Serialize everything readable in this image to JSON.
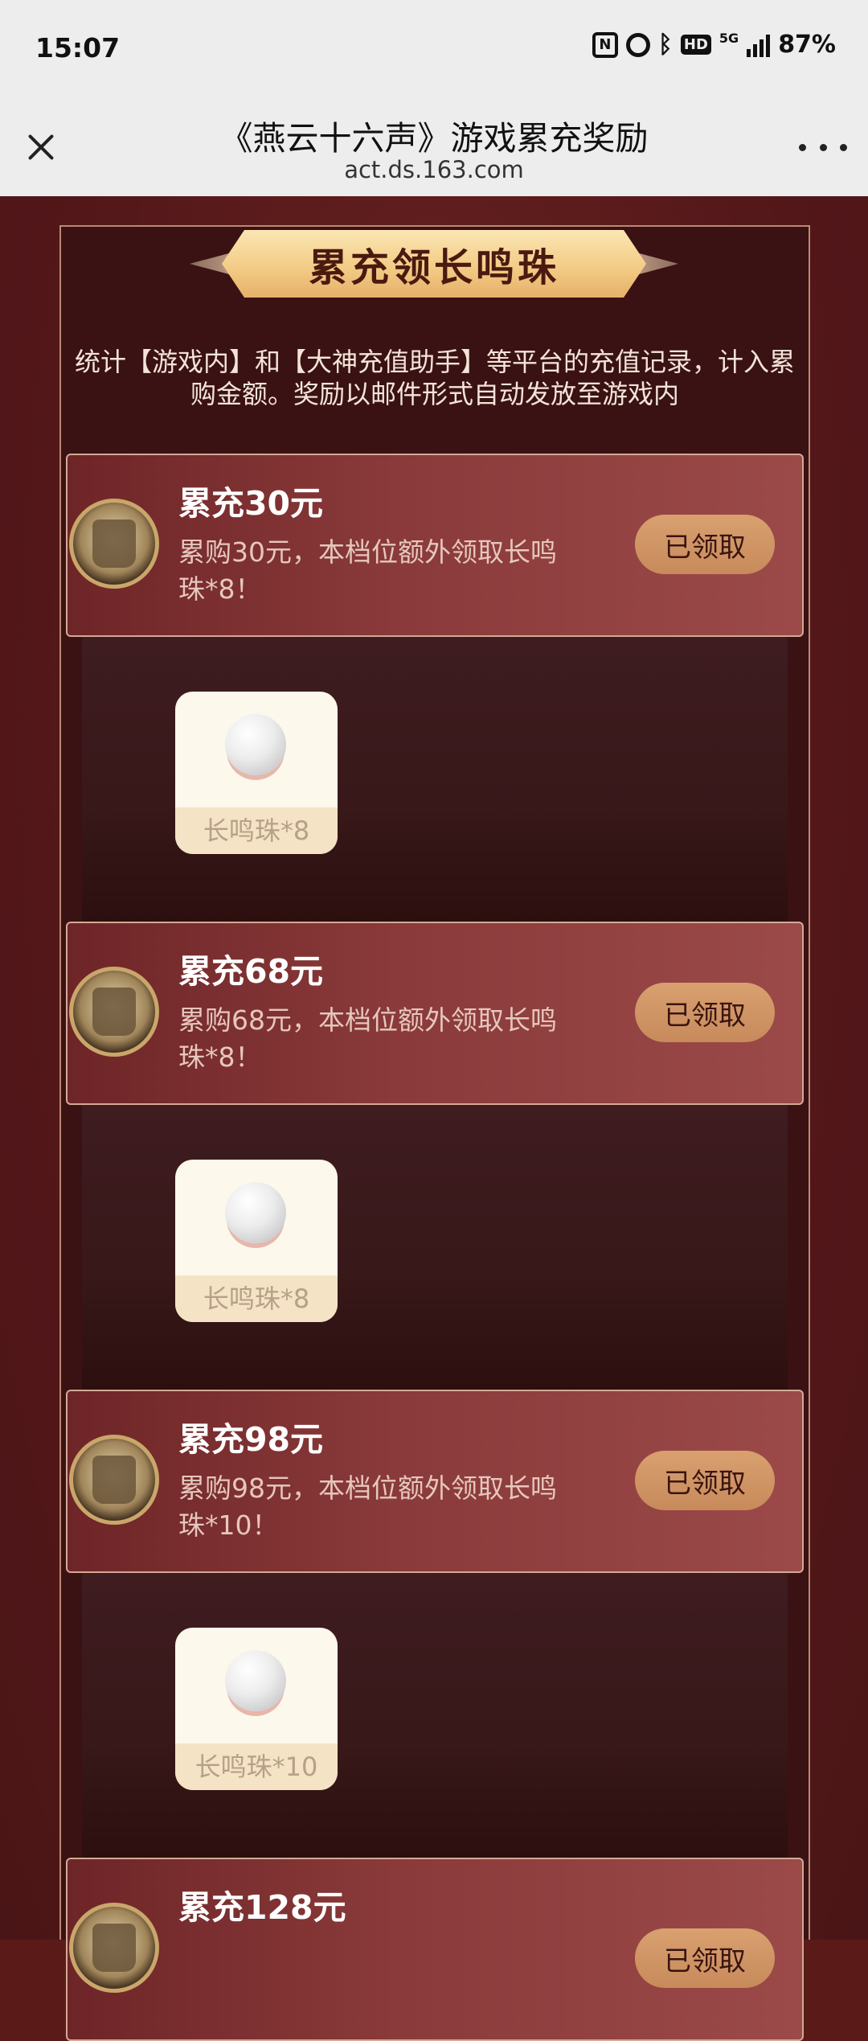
{
  "status_bar": {
    "time": "15:07",
    "network": "5G",
    "battery": "87%"
  },
  "title_bar": {
    "title": "《燕云十六声》游戏累充奖励",
    "url": "act.ds.163.com"
  },
  "banner": {
    "title": "累充领长鸣珠"
  },
  "description": "统计【游戏内】和【大神充值助手】等平台的充值记录，计入累购金额。奖励以邮件形式自动发放至游戏内",
  "tiers": [
    {
      "title": "累充30元",
      "desc": "累购30元，本档位额外领取长鸣珠*8！",
      "button": "已领取",
      "reward": {
        "icon": "pearl-icon",
        "label": "长鸣珠*8"
      }
    },
    {
      "title": "累充68元",
      "desc": "累购68元，本档位额外领取长鸣珠*8！",
      "button": "已领取",
      "reward": {
        "icon": "pearl-icon",
        "label": "长鸣珠*8"
      }
    },
    {
      "title": "累充98元",
      "desc": "累购98元，本档位额外领取长鸣珠*10！",
      "button": "已领取",
      "reward": {
        "icon": "pearl-icon",
        "label": "长鸣珠*10"
      }
    },
    {
      "title": "累充128元",
      "desc": "",
      "button": "已领取",
      "reward": {
        "icon": "pearl-icon",
        "label": ""
      }
    }
  ]
}
